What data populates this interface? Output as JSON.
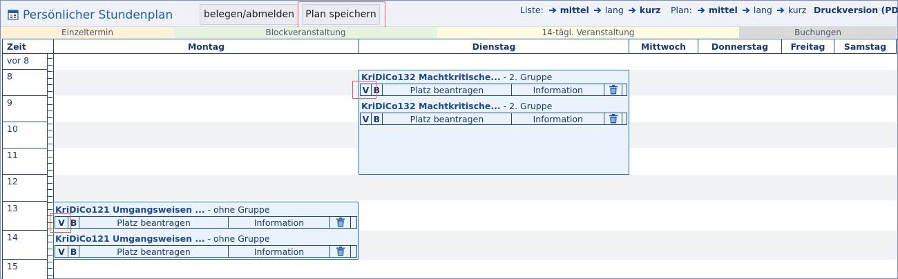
{
  "header": {
    "title": "Persönlicher Stundenplan",
    "btn_belegen": "belegen/abmelden",
    "btn_speichern": "Plan speichern",
    "liste_label": "Liste:",
    "plan_label": "Plan:",
    "opt_mittel": "mittel",
    "opt_lang": "lang",
    "opt_kurz": "kurz",
    "druck": "Druckversion (PDF)"
  },
  "legend": {
    "einzel": "Einzeltermin",
    "block": "Blockveranstaltung",
    "vierzehn": "14-tägl. Veranstaltung",
    "buchungen": "Buchungen"
  },
  "columns": {
    "zeit": "Zeit",
    "montag": "Montag",
    "dienstag": "Dienstag",
    "mittwoch": "Mittwoch",
    "donnerstag": "Donnerstag",
    "freitag": "Freitag",
    "samstag": "Samstag"
  },
  "hours": [
    "vor 8",
    "8",
    "9",
    "10",
    "11",
    "12",
    "13",
    "14",
    "15"
  ],
  "events": {
    "di1": {
      "name": "KriDiCo132 Machtkritische...",
      "group": " - 2. Gruppe"
    },
    "di2": {
      "name": "KriDiCo132 Machtkritische...",
      "group": " - 2. Gruppe"
    },
    "mo1": {
      "name": "KriDiCo121 Umgangsweisen ...",
      "group": " - ohne Gruppe"
    },
    "mo2": {
      "name": "KriDiCo121 Umgangsweisen ...",
      "group": " - ohne Gruppe"
    }
  },
  "row_labels": {
    "v": "V",
    "b": "B",
    "platz": "Platz beantragen",
    "info": "Information"
  },
  "colors": {
    "accent": "#1e4a8a",
    "event_bg": "#eaf2fb",
    "highlight": "#e06060"
  }
}
